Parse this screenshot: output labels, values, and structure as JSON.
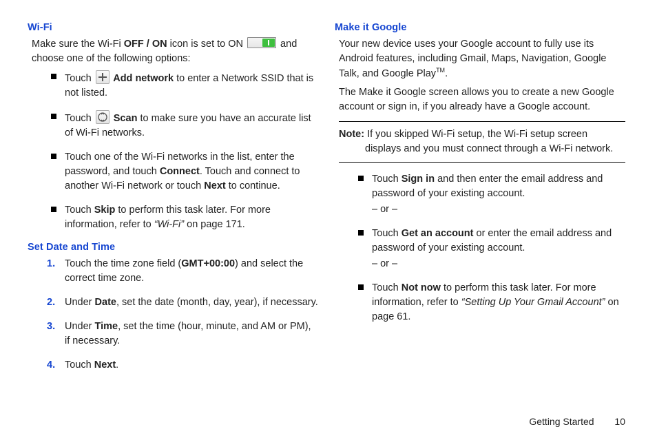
{
  "left": {
    "wifi": {
      "title": "Wi-Fi",
      "intro_1": "Make sure the Wi-Fi ",
      "intro_bold": "OFF / ON",
      "intro_2": " icon is set to ON ",
      "intro_3": " and choose one of the following options:",
      "b1_t1": "Touch ",
      "b1_bold": " Add network",
      "b1_t2": " to enter a Network SSID that is not listed.",
      "b2_t1": "Touch ",
      "b2_bold": " Scan",
      "b2_t2": " to make sure you have an accurate list of Wi-Fi networks.",
      "b3_t1": "Touch one of the Wi-Fi networks in the list, enter the password, and touch ",
      "b3_bold1": "Connect",
      "b3_t2": ". Touch and connect to another Wi-Fi network or touch ",
      "b3_bold2": "Next",
      "b3_t3": " to continue.",
      "b4_t1": "Touch ",
      "b4_bold": "Skip",
      "b4_t2": " to perform this task later. For more information, refer to ",
      "b4_ital": "“Wi-Fi”",
      "b4_t3": "  on page 171."
    },
    "date": {
      "title": "Set Date and Time",
      "s1_t1": "Touch the time zone field (",
      "s1_bold": "GMT+00:00",
      "s1_t2": ") and select the correct time zone.",
      "s2_t1": "Under ",
      "s2_bold": "Date",
      "s2_t2": ", set the date (month, day, year), if necessary.",
      "s3_t1": "Under ",
      "s3_bold": "Time",
      "s3_t2": ", set the time (hour, minute, and AM or PM), if necessary.",
      "s4_t1": "Touch ",
      "s4_bold": "Next",
      "s4_t2": "."
    }
  },
  "right": {
    "google": {
      "title": "Make it Google",
      "p1_t1": "Your new device uses your Google account to fully use its Android features, including Gmail, Maps, Navigation, Google Talk, and Google Play",
      "p1_sup": "TM",
      "p1_t2": ".",
      "p2": "The Make it Google screen allows you to create a new Google account or sign in, if you already have a Google account."
    },
    "note": {
      "label": "Note:",
      "text": " If you skipped Wi-Fi setup, the Wi-Fi setup screen displays and you must connect through a Wi-Fi network."
    },
    "bullets": {
      "b1_t1": "Touch ",
      "b1_bold": "Sign in",
      "b1_t2": " and then enter the email address and password of your existing account.",
      "or": "– or –",
      "b2_t1": "Touch ",
      "b2_bold": "Get an account",
      "b2_t2": " or enter the email address and password of your existing account.",
      "b3_t1": "Touch ",
      "b3_bold": "Not now",
      "b3_t2": " to perform this task later. For more information, refer to ",
      "b3_ital": "“Setting Up Your Gmail Account”",
      "b3_t3": " on page 61."
    }
  },
  "footer": {
    "section": "Getting Started",
    "page": "10"
  }
}
